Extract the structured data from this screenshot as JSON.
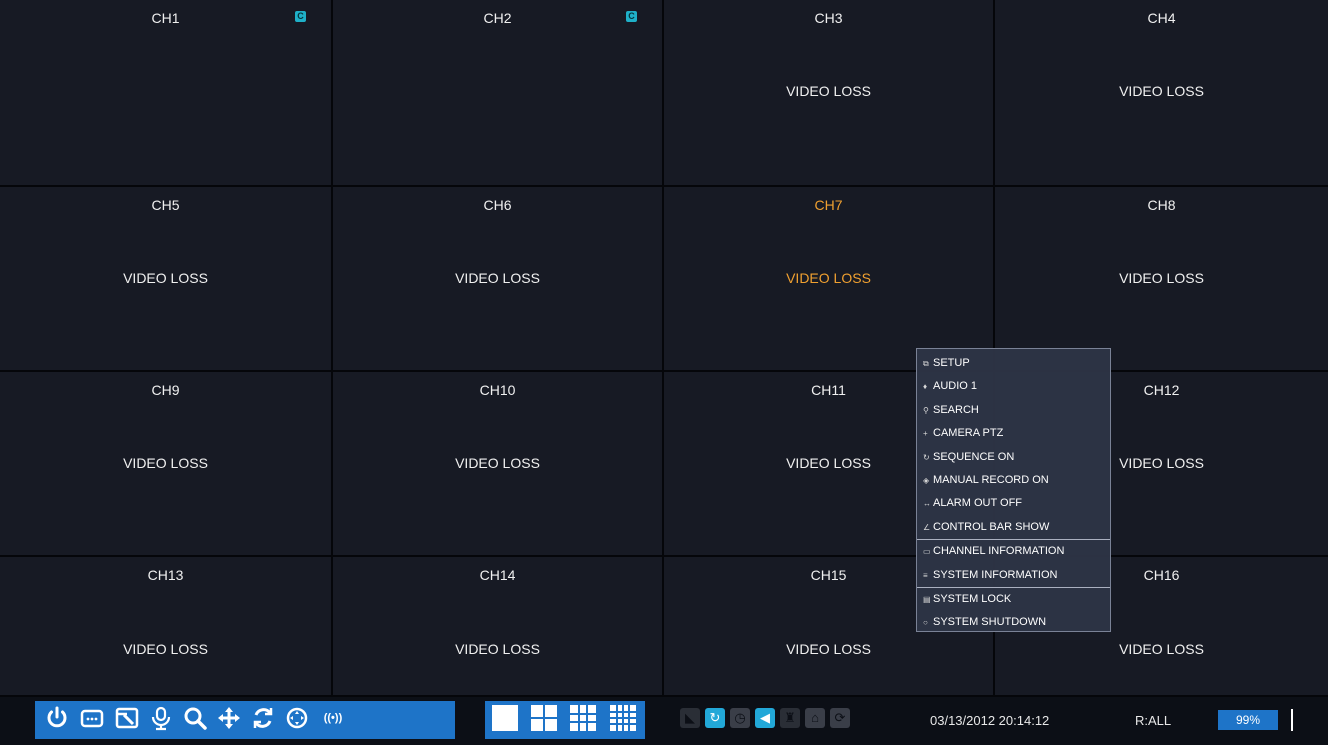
{
  "channels": [
    {
      "label": "CH1",
      "status": "",
      "badge": "C"
    },
    {
      "label": "CH2",
      "status": "",
      "badge": "C"
    },
    {
      "label": "CH3",
      "status": "VIDEO LOSS"
    },
    {
      "label": "CH4",
      "status": "VIDEO LOSS"
    },
    {
      "label": "CH5",
      "status": "VIDEO LOSS"
    },
    {
      "label": "CH6",
      "status": "VIDEO LOSS"
    },
    {
      "label": "CH7",
      "status": "VIDEO LOSS",
      "active": true
    },
    {
      "label": "CH8",
      "status": "VIDEO LOSS"
    },
    {
      "label": "CH9",
      "status": "VIDEO LOSS"
    },
    {
      "label": "CH10",
      "status": "VIDEO LOSS"
    },
    {
      "label": "CH11",
      "status": "VIDEO LOSS"
    },
    {
      "label": "CH12",
      "status": "VIDEO LOSS"
    },
    {
      "label": "CH13",
      "status": "VIDEO LOSS"
    },
    {
      "label": "CH14",
      "status": "VIDEO LOSS"
    },
    {
      "label": "CH15",
      "status": "VIDEO LOSS"
    },
    {
      "label": "CH16",
      "status": "VIDEO LOSS"
    }
  ],
  "context_menu": {
    "items": [
      {
        "label": "SETUP",
        "icon": "setup-icon",
        "glyph": "⧉"
      },
      {
        "label": "AUDIO 1",
        "icon": "audio-icon",
        "glyph": "♦"
      },
      {
        "label": "SEARCH",
        "icon": "search-icon",
        "glyph": "⚲"
      },
      {
        "label": "CAMERA PTZ",
        "icon": "ptz-icon",
        "glyph": "+"
      },
      {
        "label": "SEQUENCE ON",
        "icon": "sequence-icon",
        "glyph": "↻"
      },
      {
        "label": "MANUAL RECORD ON",
        "icon": "record-icon",
        "glyph": "◈"
      },
      {
        "label": "ALARM OUT OFF",
        "icon": "alarm-icon",
        "glyph": "↔"
      },
      {
        "label": "CONTROL BAR SHOW",
        "icon": "control-bar-icon",
        "glyph": "∠"
      },
      {
        "label": "CHANNEL INFORMATION",
        "icon": "channel-info-icon",
        "glyph": "▭"
      },
      {
        "label": "SYSTEM INFORMATION",
        "icon": "system-info-icon",
        "glyph": "≡"
      },
      {
        "label": "SYSTEM LOCK",
        "icon": "lock-icon",
        "glyph": "▤"
      },
      {
        "label": "SYSTEM SHUTDOWN",
        "icon": "shutdown-icon",
        "glyph": "○"
      }
    ]
  },
  "toolbar": {
    "datetime": "03/13/2012 20:14:12",
    "record_mode": "R:ALL",
    "hdd_usage": "99%",
    "accent": "#1e74c8"
  }
}
